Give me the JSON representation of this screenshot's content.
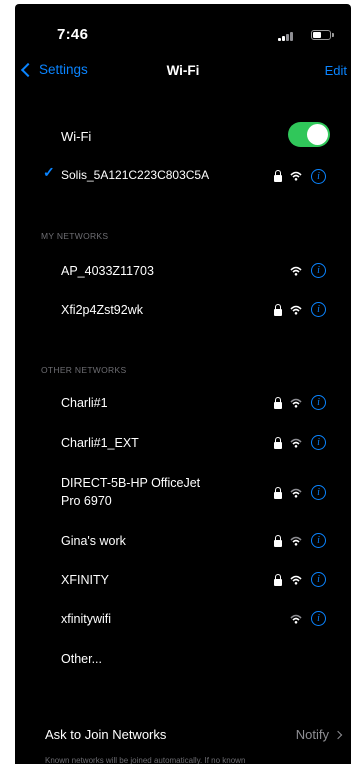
{
  "status_bar": {
    "time": "7:46"
  },
  "nav": {
    "back_label": "Settings",
    "title": "Wi-Fi",
    "edit_label": "Edit"
  },
  "wifi_toggle": {
    "label": "Wi-Fi",
    "on": true
  },
  "connected_network": {
    "name": "Solis_5A121C223C803C5A",
    "secured": true
  },
  "my_networks": {
    "header": "MY NETWORKS",
    "items": [
      {
        "name": "AP_4033Z11703",
        "secured": false
      },
      {
        "name": "Xfi2p4Zst92wk",
        "secured": true
      }
    ]
  },
  "other_networks": {
    "header": "OTHER NETWORKS",
    "items": [
      {
        "name": "Charli#1",
        "secured": true
      },
      {
        "name": "Charli#1_EXT",
        "secured": true
      },
      {
        "name": "DIRECT-5B-HP OfficeJet",
        "name_line2": "Pro 6970",
        "secured": true
      },
      {
        "name": "Gina's work",
        "secured": true
      },
      {
        "name": "XFINITY",
        "secured": true
      },
      {
        "name": "xfinitywifi",
        "secured": false
      }
    ],
    "other_label": "Other..."
  },
  "ask_to_join": {
    "label": "Ask to Join Networks",
    "value": "Notify"
  },
  "footnote": "Known networks will be joined automatically. If no known",
  "colors": {
    "accent": "#0a84ff",
    "toggle_on": "#30c75a",
    "background": "#000000"
  },
  "icons": {
    "lock": "lock-icon",
    "wifi": "wifi-icon",
    "info": "info-icon"
  }
}
